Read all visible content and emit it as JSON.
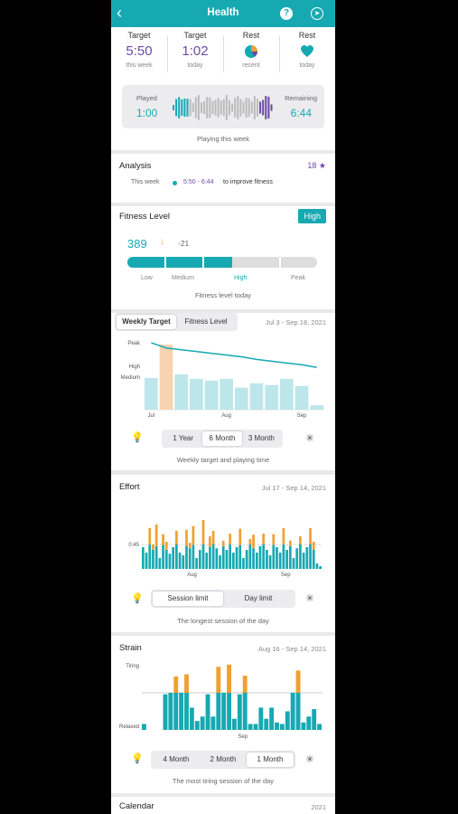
{
  "header": {
    "title": "Health",
    "back_icon": "chevron-left-icon",
    "help_label": "?",
    "share_icon": "share-icon"
  },
  "summary": {
    "stats": [
      {
        "label": "Target",
        "value": "5:50",
        "sub": "this week"
      },
      {
        "label": "Target",
        "value": "1:02",
        "sub": "today"
      },
      {
        "label": "Rest",
        "icon": "pie-icon",
        "sub": "recent"
      },
      {
        "label": "Rest",
        "icon": "heart-icon",
        "sub": "today"
      }
    ],
    "played_label": "Played",
    "played_value": "1:00",
    "remaining_label": "Remaining",
    "remaining_value": "6:44",
    "playing_progress": 0.13,
    "caption": "Playing this week"
  },
  "analysis": {
    "title": "Analysis",
    "stars": "18",
    "row_label": "This week",
    "range": "5:50 - 6:44",
    "range_suffix": "to improve fitness"
  },
  "fitness": {
    "title": "Fitness Level",
    "badge": "High",
    "value": "389",
    "delta": "-21",
    "levels": [
      "Low",
      "Medium",
      "High",
      "Peak"
    ],
    "active_level": "High",
    "level_fill": 0.55,
    "caption": "Fitness level today"
  },
  "weekly": {
    "tabs": [
      "Weekly Target",
      "Fitness Level"
    ],
    "active_tab": "Weekly Target",
    "date_range": "Jul 3 - Sep 18, 2021",
    "ranges": [
      "1 Year",
      "6 Month",
      "3 Month"
    ],
    "active_range": "6 Month",
    "caption": "Weekly target and playing time"
  },
  "effort": {
    "title": "Effort",
    "date_range": "Jul 17 - Sep 14, 2021",
    "tabs": [
      "Session limit",
      "Day limit"
    ],
    "active_tab": "Session limit",
    "caption": "The longest session of the day"
  },
  "strain": {
    "title": "Strain",
    "date_range": "Aug 16 - Sep 14, 2021",
    "ranges": [
      "4 Month",
      "2 Month",
      "1 Month"
    ],
    "active_range": "1 Month",
    "caption": "The most tiring session of the day"
  },
  "calendar": {
    "title": "Calendar",
    "year": "2021"
  },
  "colors": {
    "teal": "#17a9b2",
    "purple": "#6a4aa6",
    "orange": "#f0a030",
    "light_teal": "#bde6ea",
    "peach": "#f8d3b1"
  },
  "chart_data": [
    {
      "type": "bar",
      "title": "Weekly Target",
      "x_tick_labels": [
        "Jul",
        "Aug",
        "Sep"
      ],
      "y_tick_labels": [
        "Peak",
        "High",
        "Medium"
      ],
      "series": [
        {
          "values": [
            36,
            74,
            40,
            35,
            33,
            35,
            25,
            30,
            28,
            35,
            27,
            5
          ]
        },
        {
          "values": [
            76,
            70,
            68,
            66,
            64,
            62,
            60,
            57,
            55,
            53,
            51,
            48
          ]
        }
      ],
      "highlighted_index": 1
    },
    {
      "type": "bar",
      "title": "Effort",
      "x_tick_labels": [
        "Aug",
        "Sep"
      ],
      "reference_line_label": "0:45",
      "series": [
        {
          "values": [
            40,
            30,
            45,
            35,
            42,
            20,
            44,
            35,
            28,
            40,
            45,
            30,
            25,
            42,
            38,
            44,
            20,
            35,
            45,
            30,
            40,
            45,
            38,
            25,
            42,
            35,
            45,
            30,
            40,
            44,
            20,
            35,
            45,
            38,
            30,
            42,
            45,
            35,
            25,
            44,
            40,
            30,
            45,
            35,
            42,
            20,
            38,
            45,
            30,
            40,
            45,
            35,
            10,
            5
          ]
        },
        {
          "values": [
            0,
            0,
            30,
            10,
            40,
            0,
            20,
            15,
            0,
            0,
            25,
            0,
            0,
            30,
            10,
            35,
            0,
            0,
            45,
            0,
            20,
            25,
            0,
            0,
            10,
            0,
            20,
            0,
            0,
            30,
            0,
            0,
            10,
            25,
            0,
            0,
            20,
            0,
            0,
            20,
            0,
            0,
            30,
            0,
            10,
            0,
            0,
            15,
            0,
            0,
            30,
            15,
            0,
            0
          ]
        }
      ]
    },
    {
      "type": "bar",
      "title": "Strain",
      "x_tick_labels": [
        "Sep"
      ],
      "y_tick_labels": [
        "Tiring",
        "Relaxed"
      ],
      "series": [
        {
          "values": [
            8,
            0,
            0,
            0,
            48,
            50,
            50,
            50,
            50,
            30,
            12,
            18,
            48,
            18,
            50,
            50,
            50,
            15,
            48,
            50,
            8,
            8,
            30,
            15,
            30,
            10,
            8,
            25,
            50,
            50,
            10,
            18,
            28,
            8
          ]
        },
        {
          "values": [
            0,
            0,
            0,
            0,
            0,
            0,
            22,
            0,
            25,
            0,
            0,
            0,
            0,
            0,
            35,
            0,
            38,
            0,
            0,
            23,
            0,
            0,
            0,
            0,
            0,
            0,
            0,
            0,
            0,
            30,
            0,
            0,
            0,
            0
          ]
        }
      ]
    }
  ]
}
